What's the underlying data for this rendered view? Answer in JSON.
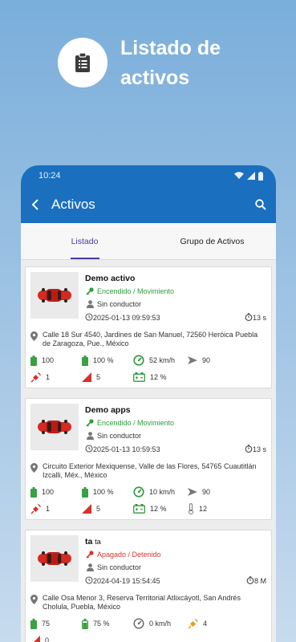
{
  "promo": {
    "title": "Listado de activos",
    "icon": "clipboard-icon"
  },
  "status": {
    "time": "10:24"
  },
  "appbar": {
    "title": "Activos"
  },
  "tabs": [
    {
      "label": "Listado",
      "active": true
    },
    {
      "label": "Grupo de Activos",
      "active": false
    }
  ],
  "assets": [
    {
      "name": "Demo activo",
      "name_suffix": "",
      "state": "Encendido / Movimiento",
      "state_color": "#2e9b3a",
      "driver": "Sin conductor",
      "datetime": "2025-01-13 09:59:53",
      "elapsed": "13 s",
      "address": "Calle 18 Sur 4540, Jardines de San Manuel, 72560 Heróica Puebla de Zaragoza, Pue., México",
      "metrics": [
        "100",
        "100 %",
        "52 km/h",
        "90",
        "1",
        "5",
        "12 %",
        ""
      ]
    },
    {
      "name": "Demo apps",
      "name_suffix": "",
      "state": "Encendido / Movimiento",
      "state_color": "#2e9b3a",
      "driver": "Sin conductor",
      "datetime": "2025-01-13 10:59:53",
      "elapsed": "13 s",
      "address": "Circuito Exterior Mexiquense, Valle de las Flores, 54765 Cuautitlán Izcalli, Méx., México",
      "metrics": [
        "100",
        "100 %",
        "10 km/h",
        "90",
        "1",
        "5",
        "12 %",
        "12"
      ]
    },
    {
      "name": "ta",
      "name_suffix": "ta",
      "state": "Apagado / Detenido",
      "state_color": "#d6322e",
      "driver": "Sin conductor",
      "datetime": "2024-04-19 15:54:45",
      "elapsed": "8 M",
      "address": "Calle Osa Menor 3, Reserva Territorial Atlixcáyotl, San Andrés Cholula, Puebla, México",
      "metrics": [
        "75",
        "75 %",
        "0 km/h",
        "4",
        "0"
      ]
    }
  ]
}
